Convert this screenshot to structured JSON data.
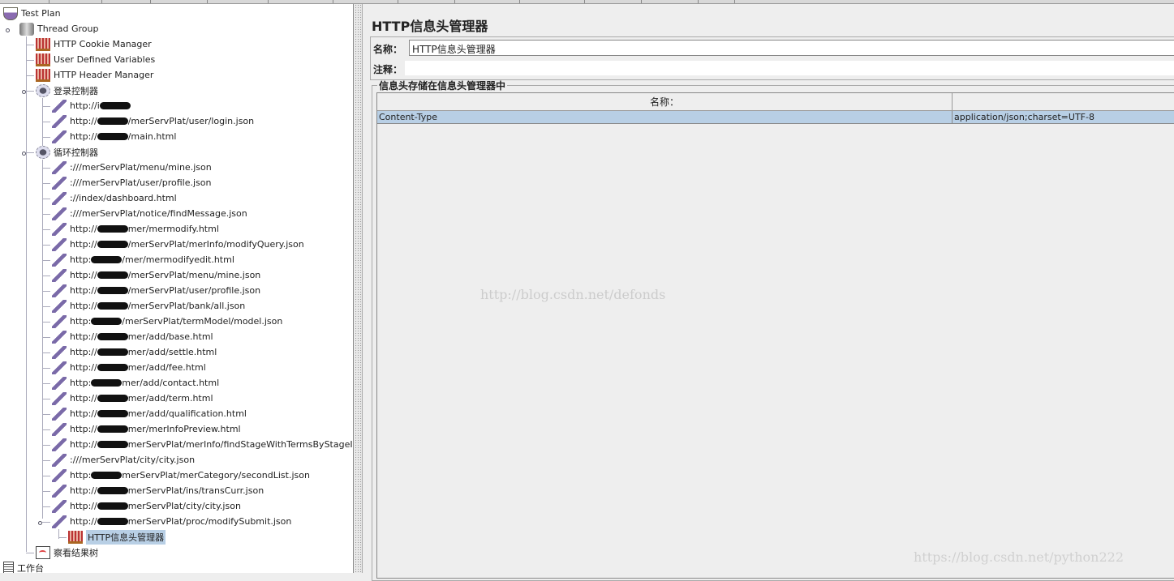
{
  "tree": [
    {
      "label": "Test Plan",
      "icon": "test-plan-icon",
      "level": 0
    },
    {
      "label": "Thread Group",
      "icon": "thread-group-icon",
      "level": 1
    },
    {
      "label": "HTTP Cookie Manager",
      "icon": "config-element-icon",
      "level": 2
    },
    {
      "label": "User Defined Variables",
      "icon": "config-element-icon",
      "level": 2
    },
    {
      "label": "HTTP Header Manager",
      "icon": "config-element-icon",
      "level": 2
    },
    {
      "label": "登录控制器",
      "icon": "controller-icon",
      "level": 2
    },
    {
      "label": "http://i",
      "suffix": "",
      "redacted": true,
      "icon": "sampler-icon",
      "level": 3
    },
    {
      "label": "http://",
      "suffix": "/merServPlat/user/login.json",
      "redacted": true,
      "icon": "sampler-icon",
      "level": 3
    },
    {
      "label": "http://",
      "suffix": "/main.html",
      "redacted": true,
      "icon": "sampler-icon",
      "level": 3
    },
    {
      "label": "循环控制器",
      "icon": "controller-icon",
      "level": 2
    },
    {
      "label": ":///merServPlat/menu/mine.json",
      "icon": "sampler-icon",
      "level": 3
    },
    {
      "label": ":///merServPlat/user/profile.json",
      "icon": "sampler-icon",
      "level": 3
    },
    {
      "label": "://index/dashboard.html",
      "icon": "sampler-icon",
      "level": 3
    },
    {
      "label": ":///merServPlat/notice/findMessage.json",
      "icon": "sampler-icon",
      "level": 3
    },
    {
      "label": "http://",
      "suffix": "mer/mermodify.html",
      "redacted": true,
      "icon": "sampler-icon",
      "level": 3
    },
    {
      "label": "http://",
      "suffix": "/merServPlat/merInfo/modifyQuery.json",
      "redacted": true,
      "icon": "sampler-icon",
      "level": 3
    },
    {
      "label": "http:",
      "suffix": "/mer/mermodifyedit.html",
      "redacted": true,
      "icon": "sampler-icon",
      "level": 3
    },
    {
      "label": "http://",
      "suffix": "/merServPlat/menu/mine.json",
      "redacted": true,
      "icon": "sampler-icon",
      "level": 3
    },
    {
      "label": "http://",
      "suffix": "/merServPlat/user/profile.json",
      "redacted": true,
      "icon": "sampler-icon",
      "level": 3
    },
    {
      "label": "http://",
      "suffix": "/merServPlat/bank/all.json",
      "redacted": true,
      "icon": "sampler-icon",
      "level": 3
    },
    {
      "label": "http:",
      "suffix": "/merServPlat/termModel/model.json",
      "redacted": true,
      "icon": "sampler-icon",
      "level": 3
    },
    {
      "label": "http://",
      "suffix": "mer/add/base.html",
      "redacted": true,
      "icon": "sampler-icon",
      "level": 3
    },
    {
      "label": "http://",
      "suffix": "mer/add/settle.html",
      "redacted": true,
      "icon": "sampler-icon",
      "level": 3
    },
    {
      "label": "http://",
      "suffix": "mer/add/fee.html",
      "redacted": true,
      "icon": "sampler-icon",
      "level": 3
    },
    {
      "label": "http:",
      "suffix": "mer/add/contact.html",
      "redacted": true,
      "icon": "sampler-icon",
      "level": 3
    },
    {
      "label": "http://",
      "suffix": "mer/add/term.html",
      "redacted": true,
      "icon": "sampler-icon",
      "level": 3
    },
    {
      "label": "http://",
      "suffix": "mer/add/qualification.html",
      "redacted": true,
      "icon": "sampler-icon",
      "level": 3
    },
    {
      "label": "http://",
      "suffix": "mer/merInfoPreview.html",
      "redacted": true,
      "icon": "sampler-icon",
      "level": 3
    },
    {
      "label": "http://",
      "suffix": "merServPlat/merInfo/findStageWithTermsByStageId.json",
      "redacted": true,
      "icon": "sampler-icon",
      "level": 3
    },
    {
      "label": ":///merServPlat/city/city.json",
      "icon": "sampler-icon",
      "level": 3
    },
    {
      "label": "http:",
      "suffix": "merServPlat/merCategory/secondList.json",
      "redacted": true,
      "icon": "sampler-icon",
      "level": 3
    },
    {
      "label": "http://",
      "suffix": "merServPlat/ins/transCurr.json",
      "redacted": true,
      "icon": "sampler-icon",
      "level": 3
    },
    {
      "label": "http://",
      "suffix": "merServPlat/city/city.json",
      "redacted": true,
      "icon": "sampler-icon",
      "level": 3
    },
    {
      "label": "http://",
      "suffix": "merServPlat/proc/modifySubmit.json",
      "redacted": true,
      "icon": "sampler-icon",
      "level": 3
    },
    {
      "label": "HTTP信息头管理器",
      "icon": "config-element-icon",
      "level": 4,
      "selected": true
    },
    {
      "label": "察看结果树",
      "icon": "listener-icon",
      "level": 2
    },
    {
      "label": "工作台",
      "icon": "workbench-icon",
      "level": 0
    }
  ],
  "panel": {
    "title": "HTTP信息头管理器",
    "name_label": "名称：",
    "name_value": "HTTP信息头管理器",
    "comment_label": "注释：",
    "comment_value": "",
    "group_title": "信息头存储在信息头管理器中",
    "columns": [
      "名称：",
      ""
    ],
    "rows": [
      {
        "name": "Content-Type",
        "value": "application/json;charset=UTF-8"
      }
    ]
  },
  "watermarks": [
    "http://blog.csdn.net/defonds",
    "https://blog.csdn.net/python222"
  ],
  "colors": {
    "selection": "#b8cfe5",
    "panel_bg": "#eeeeee"
  }
}
